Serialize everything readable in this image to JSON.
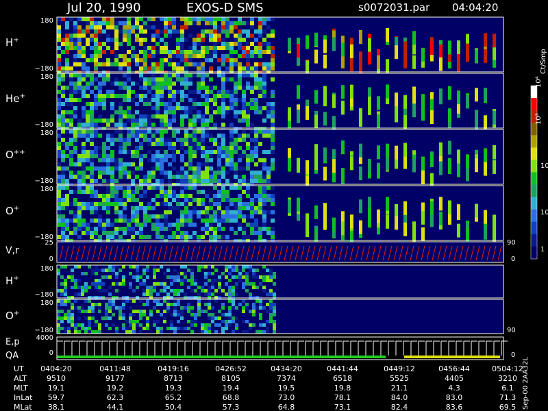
{
  "header": {
    "date": "Jul 20, 1990",
    "instrument": "EXOS-D SMS",
    "file": "s0072031.par",
    "time": "04:04:20"
  },
  "colorbar": {
    "unit": "Ct/Smp",
    "ticks": [
      "1",
      "10",
      "100",
      "10³",
      "10⁴"
    ],
    "colors": [
      "#000066",
      "#0a1a8a",
      "#1040c0",
      "#2a70e0",
      "#30b0d0",
      "#20a060",
      "#10c020",
      "#80e010",
      "#e0e010",
      "#b0a000",
      "#806000",
      "#c02000",
      "#ff0000",
      "#ffffff"
    ]
  },
  "panels": [
    {
      "label": "H",
      "sup": "+",
      "ymax": "180",
      "ymin": "−180"
    },
    {
      "label": "He",
      "sup": "+",
      "ymax": "180",
      "ymin": "−180"
    },
    {
      "label": "O",
      "sup": "++",
      "ymax": "180",
      "ymin": "−180"
    },
    {
      "label": "O",
      "sup": "+",
      "ymax": "180",
      "ymin": "−180"
    }
  ],
  "vr_panel": {
    "label": "V,r",
    "ytop": "25",
    "ybot": "0",
    "rtop": "90",
    "rbot": "0"
  },
  "lower_panels": [
    {
      "label": "H",
      "sup": "+",
      "ymax": "180",
      "ymin": "−180"
    },
    {
      "label": "O",
      "sup": "+",
      "ymax": "180",
      "ymin": "−180",
      "right": "90"
    }
  ],
  "ep_panel": {
    "label1": "E,p",
    "label2": "QA",
    "ytop": "4000",
    "ybot": "0",
    "rbot": "0"
  },
  "orbit_table": {
    "rows": [
      {
        "name": "UT",
        "values": [
          "0404:20",
          "0411:48",
          "0419:16",
          "0426:52",
          "0434:20",
          "0441:44",
          "0449:12",
          "0456:44",
          "0504:12"
        ]
      },
      {
        "name": "ALT",
        "values": [
          "9510",
          "9177",
          "8713",
          "8105",
          "7374",
          "6518",
          "5525",
          "4405",
          "3210"
        ]
      },
      {
        "name": "MLT",
        "values": [
          "19.1",
          "19.2",
          "19.3",
          "19.4",
          "19.5",
          "19.8",
          "21.1",
          "4.3",
          "6.1"
        ]
      },
      {
        "name": "InLat",
        "values": [
          "59.7",
          "62.3",
          "65.2",
          "68.8",
          "73.0",
          "78.1",
          "84.0",
          "83.0",
          "71.3"
        ]
      },
      {
        "name": "MLat",
        "values": [
          "38.1",
          "44.1",
          "50.4",
          "57.3",
          "64.8",
          "73.1",
          "82.4",
          "83.6",
          "69.5"
        ]
      }
    ]
  },
  "side_stamp": "Sep-00 2AA32L"
}
